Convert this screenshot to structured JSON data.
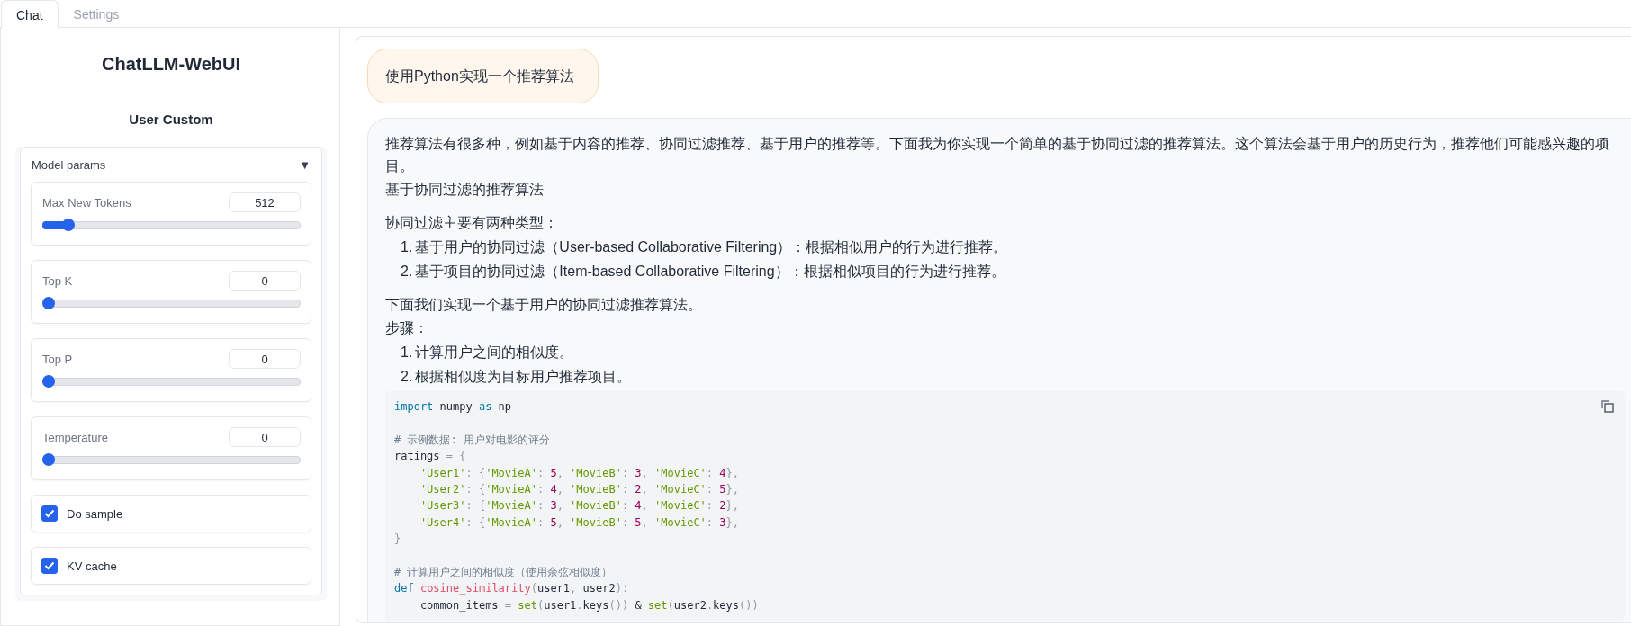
{
  "tabs": [
    {
      "label": "Chat",
      "selected": true
    },
    {
      "label": "Settings",
      "selected": false
    }
  ],
  "sidebar": {
    "title": "ChatLLM-WebUI",
    "subtitle": "User Custom",
    "accordion": {
      "label": "Model params",
      "toggle": "▼",
      "expanded": true,
      "params": [
        {
          "kind": "slider",
          "label": "Max New Tokens",
          "value": "512",
          "level": 0.08
        },
        {
          "kind": "slider",
          "label": "Top K",
          "value": "0",
          "level": 0
        },
        {
          "kind": "slider",
          "label": "Top P",
          "value": "0",
          "level": 0
        },
        {
          "kind": "slider",
          "label": "Temperature",
          "value": "0",
          "level": 0
        },
        {
          "kind": "checkbox",
          "label": "Do sample",
          "checked": true
        },
        {
          "kind": "checkbox",
          "label": "KV cache",
          "checked": true
        }
      ]
    }
  },
  "chat": {
    "messages": [
      {
        "kind": "prompt",
        "blocks": [
          {
            "kind": "paragraph",
            "lines": [
              "使用Python实现一个推荐算法"
            ]
          }
        ]
      },
      {
        "kind": "reply",
        "blocks": [
          {
            "kind": "paragraph",
            "lines": [
              "推荐算法有很多种，例如基于内容的推荐、协同过滤推荐、基于用户的推荐等。下面我为你实现一个简单的基于协同过滤的推荐算法。这个算法会基于用户的历史行为，推荐他们可能感兴趣的项目。",
              "基于协同过滤的推荐算法"
            ]
          },
          {
            "kind": "paragraph",
            "lines": [
              "协同过滤主要有两种类型："
            ]
          },
          {
            "kind": "list",
            "items": [
              {
                "number": "1.",
                "text": "基于用户的协同过滤（User-based Collaborative Filtering）：根据相似用户的行为进行推荐。"
              },
              {
                "number": "2.",
                "text": "基于项目的协同过滤（Item-based Collaborative Filtering）：根据相似项目的行为进行推荐。"
              }
            ]
          },
          {
            "kind": "paragraph",
            "lines": [
              "下面我们实现一个基于用户的协同过滤推荐算法。",
              "步骤："
            ]
          },
          {
            "kind": "list",
            "items": [
              {
                "number": "1.",
                "text": "计算用户之间的相似度。"
              },
              {
                "number": "2.",
                "text": "根据相似度为目标用户推荐项目。"
              }
            ]
          },
          {
            "kind": "code",
            "lines": [
              {
                "kind": "code",
                "tokens": [
                  {
                    "kind": "kw",
                    "text": "import"
                  },
                  {
                    "kind": "plain",
                    "text": " numpy "
                  },
                  {
                    "kind": "kw",
                    "text": "as"
                  },
                  {
                    "kind": "plain",
                    "text": " np"
                  }
                ]
              },
              {
                "kind": "blank"
              },
              {
                "kind": "code",
                "tokens": [
                  {
                    "kind": "comment",
                    "text": "# 示例数据: 用户对电影的评分"
                  }
                ]
              },
              {
                "kind": "code",
                "tokens": [
                  {
                    "kind": "plain",
                    "text": "ratings "
                  },
                  {
                    "kind": "punct",
                    "text": "= {"
                  }
                ]
              },
              {
                "kind": "code",
                "tokens": [
                  {
                    "kind": "str",
                    "text": "    'User1'"
                  },
                  {
                    "kind": "punct",
                    "text": ": {"
                  },
                  {
                    "kind": "str",
                    "text": "'MovieA'"
                  },
                  {
                    "kind": "punct",
                    "text": ": "
                  },
                  {
                    "kind": "num",
                    "text": "5"
                  },
                  {
                    "kind": "punct",
                    "text": ", "
                  },
                  {
                    "kind": "str",
                    "text": "'MovieB'"
                  },
                  {
                    "kind": "punct",
                    "text": ": "
                  },
                  {
                    "kind": "num",
                    "text": "3"
                  },
                  {
                    "kind": "punct",
                    "text": ", "
                  },
                  {
                    "kind": "str",
                    "text": "'MovieC'"
                  },
                  {
                    "kind": "punct",
                    "text": ": "
                  },
                  {
                    "kind": "num",
                    "text": "4"
                  },
                  {
                    "kind": "punct",
                    "text": "},"
                  }
                ]
              },
              {
                "kind": "code",
                "tokens": [
                  {
                    "kind": "str",
                    "text": "    'User2'"
                  },
                  {
                    "kind": "punct",
                    "text": ": {"
                  },
                  {
                    "kind": "str",
                    "text": "'MovieA'"
                  },
                  {
                    "kind": "punct",
                    "text": ": "
                  },
                  {
                    "kind": "num",
                    "text": "4"
                  },
                  {
                    "kind": "punct",
                    "text": ", "
                  },
                  {
                    "kind": "str",
                    "text": "'MovieB'"
                  },
                  {
                    "kind": "punct",
                    "text": ": "
                  },
                  {
                    "kind": "num",
                    "text": "2"
                  },
                  {
                    "kind": "punct",
                    "text": ", "
                  },
                  {
                    "kind": "str",
                    "text": "'MovieC'"
                  },
                  {
                    "kind": "punct",
                    "text": ": "
                  },
                  {
                    "kind": "num",
                    "text": "5"
                  },
                  {
                    "kind": "punct",
                    "text": "},"
                  }
                ]
              },
              {
                "kind": "code",
                "tokens": [
                  {
                    "kind": "str",
                    "text": "    'User3'"
                  },
                  {
                    "kind": "punct",
                    "text": ": {"
                  },
                  {
                    "kind": "str",
                    "text": "'MovieA'"
                  },
                  {
                    "kind": "punct",
                    "text": ": "
                  },
                  {
                    "kind": "num",
                    "text": "3"
                  },
                  {
                    "kind": "punct",
                    "text": ", "
                  },
                  {
                    "kind": "str",
                    "text": "'MovieB'"
                  },
                  {
                    "kind": "punct",
                    "text": ": "
                  },
                  {
                    "kind": "num",
                    "text": "4"
                  },
                  {
                    "kind": "punct",
                    "text": ", "
                  },
                  {
                    "kind": "str",
                    "text": "'MovieC'"
                  },
                  {
                    "kind": "punct",
                    "text": ": "
                  },
                  {
                    "kind": "num",
                    "text": "2"
                  },
                  {
                    "kind": "punct",
                    "text": "},"
                  }
                ]
              },
              {
                "kind": "code",
                "tokens": [
                  {
                    "kind": "str",
                    "text": "    'User4'"
                  },
                  {
                    "kind": "punct",
                    "text": ": {"
                  },
                  {
                    "kind": "str",
                    "text": "'MovieA'"
                  },
                  {
                    "kind": "punct",
                    "text": ": "
                  },
                  {
                    "kind": "num",
                    "text": "5"
                  },
                  {
                    "kind": "punct",
                    "text": ", "
                  },
                  {
                    "kind": "str",
                    "text": "'MovieB'"
                  },
                  {
                    "kind": "punct",
                    "text": ": "
                  },
                  {
                    "kind": "num",
                    "text": "5"
                  },
                  {
                    "kind": "punct",
                    "text": ", "
                  },
                  {
                    "kind": "str",
                    "text": "'MovieC'"
                  },
                  {
                    "kind": "punct",
                    "text": ": "
                  },
                  {
                    "kind": "num",
                    "text": "3"
                  },
                  {
                    "kind": "punct",
                    "text": "},"
                  }
                ]
              },
              {
                "kind": "code",
                "tokens": [
                  {
                    "kind": "punct",
                    "text": "}"
                  }
                ]
              },
              {
                "kind": "blank"
              },
              {
                "kind": "code",
                "tokens": [
                  {
                    "kind": "comment",
                    "text": "# 计算用户之间的相似度（使用余弦相似度）"
                  }
                ]
              },
              {
                "kind": "code",
                "tokens": [
                  {
                    "kind": "kw",
                    "text": "def "
                  },
                  {
                    "kind": "fn",
                    "text": "cosine_similarity"
                  },
                  {
                    "kind": "punct",
                    "text": "("
                  },
                  {
                    "kind": "plain",
                    "text": "user1"
                  },
                  {
                    "kind": "punct",
                    "text": ", "
                  },
                  {
                    "kind": "plain",
                    "text": "user2"
                  },
                  {
                    "kind": "punct",
                    "text": "):"
                  }
                ]
              },
              {
                "kind": "code",
                "tokens": [
                  {
                    "kind": "plain",
                    "text": "    common_items "
                  },
                  {
                    "kind": "punct",
                    "text": "= "
                  },
                  {
                    "kind": "builtin",
                    "text": "set"
                  },
                  {
                    "kind": "punct",
                    "text": "("
                  },
                  {
                    "kind": "plain",
                    "text": "user1"
                  },
                  {
                    "kind": "punct",
                    "text": "."
                  },
                  {
                    "kind": "plain",
                    "text": "keys"
                  },
                  {
                    "kind": "punct",
                    "text": "()) "
                  },
                  {
                    "kind": "plain",
                    "text": "& "
                  },
                  {
                    "kind": "builtin",
                    "text": "set"
                  },
                  {
                    "kind": "punct",
                    "text": "("
                  },
                  {
                    "kind": "plain",
                    "text": "user2"
                  },
                  {
                    "kind": "punct",
                    "text": "."
                  },
                  {
                    "kind": "plain",
                    "text": "keys"
                  },
                  {
                    "kind": "punct",
                    "text": "())"
                  }
                ]
              }
            ]
          }
        ]
      }
    ]
  }
}
